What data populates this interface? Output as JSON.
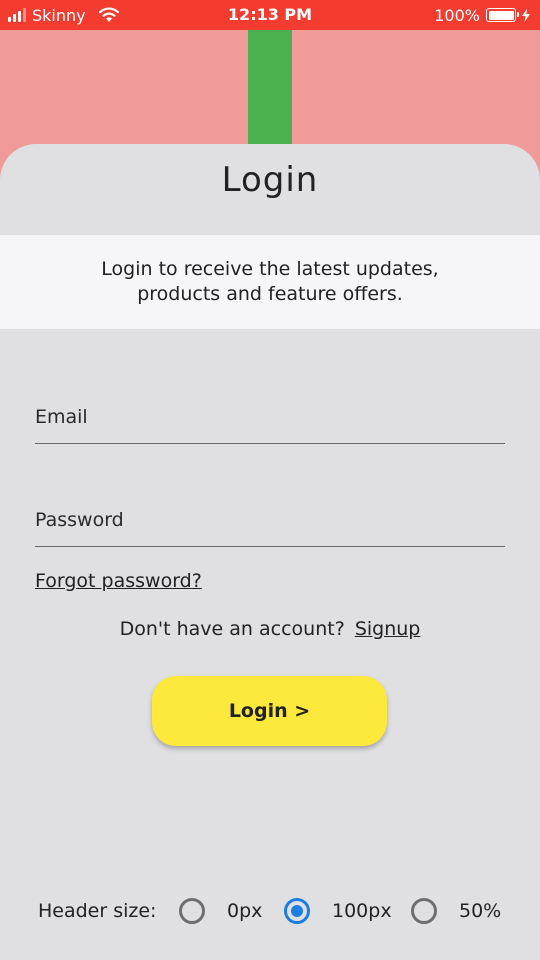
{
  "status_bar": {
    "carrier": "Skinny",
    "time": "12:13 PM",
    "battery": "100%",
    "background_color": "#f33b2f"
  },
  "header": {
    "background_color": "#f19a9a",
    "bar_color": "#4caf50"
  },
  "card": {
    "title": "Login",
    "subtitle": "Login to receive the latest updates, products and feature offers.",
    "email": {
      "label": "Email",
      "value": ""
    },
    "password": {
      "label": "Password",
      "value": ""
    },
    "forgot_password": "Forgot password?",
    "signup_prompt": "Don't have an account?",
    "signup_link": "Signup",
    "login_button": "Login >",
    "login_button_color": "#fde93b"
  },
  "header_size": {
    "label": "Header size:",
    "options": [
      {
        "label": "0px",
        "selected": false
      },
      {
        "label": "100px",
        "selected": true
      },
      {
        "label": "50%",
        "selected": false
      }
    ],
    "selected_color": "#1a7fe0"
  }
}
